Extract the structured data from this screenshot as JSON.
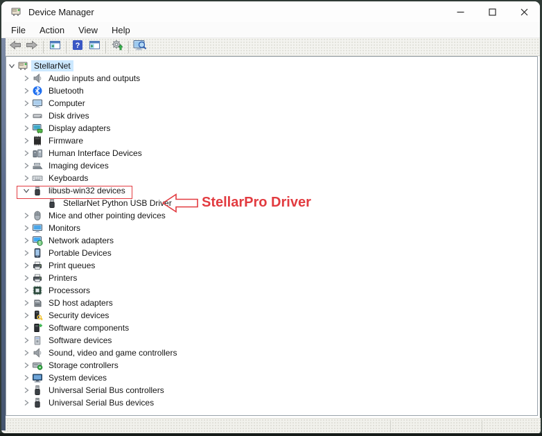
{
  "window": {
    "title": "Device Manager",
    "controls": [
      {
        "name": "minimize-button",
        "icon": "minimize"
      },
      {
        "name": "maximize-button",
        "icon": "maximize"
      },
      {
        "name": "close-button",
        "icon": "close"
      }
    ]
  },
  "menu": {
    "items": [
      "File",
      "Action",
      "View",
      "Help"
    ]
  },
  "toolbar": {
    "buttons": [
      {
        "name": "back-button",
        "icon": "arrow-left",
        "sep_after": false
      },
      {
        "name": "forward-button",
        "icon": "arrow-right",
        "sep_after": true
      },
      {
        "name": "console-tree-toggle-button",
        "icon": "console-tree",
        "sep_after": true
      },
      {
        "name": "help-button",
        "icon": "help",
        "sep_after": false
      },
      {
        "name": "action-pane-toggle-button",
        "icon": "action-pane",
        "sep_after": true
      },
      {
        "name": "update-driver-button",
        "icon": "gear-update",
        "sep_after": true
      },
      {
        "name": "scan-hardware-changes-button",
        "icon": "scan-computer",
        "sep_after": false
      }
    ]
  },
  "tree": {
    "items": [
      {
        "label": "StellarNet",
        "icon": "device-manager",
        "level": 0,
        "chevron": "down",
        "selected": true,
        "boxed": false
      },
      {
        "label": "Audio inputs and outputs",
        "icon": "speaker",
        "level": 1,
        "chevron": "right",
        "selected": false,
        "boxed": false
      },
      {
        "label": "Bluetooth",
        "icon": "bluetooth",
        "level": 1,
        "chevron": "right",
        "selected": false,
        "boxed": false
      },
      {
        "label": "Computer",
        "icon": "computer",
        "level": 1,
        "chevron": "right",
        "selected": false,
        "boxed": false
      },
      {
        "label": "Disk drives",
        "icon": "disk-drive",
        "level": 1,
        "chevron": "right",
        "selected": false,
        "boxed": false
      },
      {
        "label": "Display adapters",
        "icon": "display-adapter",
        "level": 1,
        "chevron": "right",
        "selected": false,
        "boxed": false
      },
      {
        "label": "Firmware",
        "icon": "firmware-chip",
        "level": 1,
        "chevron": "right",
        "selected": false,
        "boxed": false
      },
      {
        "label": "Human Interface Devices",
        "icon": "hid-devices",
        "level": 1,
        "chevron": "right",
        "selected": false,
        "boxed": false
      },
      {
        "label": "Imaging devices",
        "icon": "imaging-scanner",
        "level": 1,
        "chevron": "right",
        "selected": false,
        "boxed": false
      },
      {
        "label": "Keyboards",
        "icon": "keyboard",
        "level": 1,
        "chevron": "right",
        "selected": false,
        "boxed": false
      },
      {
        "label": "libusb-win32 devices",
        "icon": "usb-plug",
        "level": 1,
        "chevron": "down",
        "selected": false,
        "boxed": true
      },
      {
        "label": "StellarNet Python USB Driver",
        "icon": "usb-plug",
        "level": 2,
        "chevron": null,
        "selected": false,
        "boxed": false
      },
      {
        "label": "Mice and other pointing devices",
        "icon": "mouse",
        "level": 1,
        "chevron": "right",
        "selected": false,
        "boxed": false
      },
      {
        "label": "Monitors",
        "icon": "monitor",
        "level": 1,
        "chevron": "right",
        "selected": false,
        "boxed": false
      },
      {
        "label": "Network adapters",
        "icon": "network-adapter",
        "level": 1,
        "chevron": "right",
        "selected": false,
        "boxed": false
      },
      {
        "label": "Portable Devices",
        "icon": "portable-device",
        "level": 1,
        "chevron": "right",
        "selected": false,
        "boxed": false
      },
      {
        "label": "Print queues",
        "icon": "printer",
        "level": 1,
        "chevron": "right",
        "selected": false,
        "boxed": false
      },
      {
        "label": "Printers",
        "icon": "printer",
        "level": 1,
        "chevron": "right",
        "selected": false,
        "boxed": false
      },
      {
        "label": "Processors",
        "icon": "processor-chip",
        "level": 1,
        "chevron": "right",
        "selected": false,
        "boxed": false
      },
      {
        "label": "SD host adapters",
        "icon": "sd-card",
        "level": 1,
        "chevron": "right",
        "selected": false,
        "boxed": false
      },
      {
        "label": "Security devices",
        "icon": "security-key",
        "level": 1,
        "chevron": "right",
        "selected": false,
        "boxed": false
      },
      {
        "label": "Software components",
        "icon": "software-component",
        "level": 1,
        "chevron": "right",
        "selected": false,
        "boxed": false
      },
      {
        "label": "Software devices",
        "icon": "software-device",
        "level": 1,
        "chevron": "right",
        "selected": false,
        "boxed": false
      },
      {
        "label": "Sound, video and game controllers",
        "icon": "speaker",
        "level": 1,
        "chevron": "right",
        "selected": false,
        "boxed": false
      },
      {
        "label": "Storage controllers",
        "icon": "storage-controller",
        "level": 1,
        "chevron": "right",
        "selected": false,
        "boxed": false
      },
      {
        "label": "System devices",
        "icon": "system-device",
        "level": 1,
        "chevron": "right",
        "selected": false,
        "boxed": false
      },
      {
        "label": "Universal Serial Bus controllers",
        "icon": "usb-plug",
        "level": 1,
        "chevron": "right",
        "selected": false,
        "boxed": false
      },
      {
        "label": "Universal Serial Bus devices",
        "icon": "usb-plug",
        "level": 1,
        "chevron": "right",
        "selected": false,
        "boxed": false
      }
    ]
  },
  "annotation": {
    "label": "StellarPro Driver",
    "color": "#e23b40",
    "target": "StellarNet Python USB Driver"
  },
  "colors": {
    "selection": "#cce8ff",
    "annotation_red": "#e23b40"
  },
  "statusbar": {
    "sections": [
      "",
      "",
      ""
    ]
  }
}
